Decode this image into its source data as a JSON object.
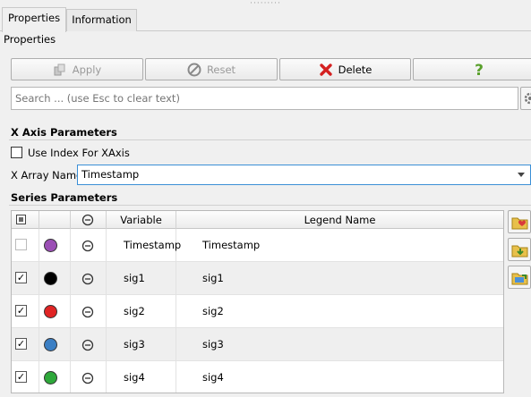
{
  "tabs": [
    {
      "label": "Properties",
      "active": true
    },
    {
      "label": "Information",
      "active": false
    }
  ],
  "panel_label": "Properties",
  "buttons": {
    "apply": "Apply",
    "reset": "Reset",
    "delete": "Delete",
    "help_icon": "question-mark-icon"
  },
  "search": {
    "placeholder": "Search ... (use Esc to clear text)",
    "value": ""
  },
  "x_axis": {
    "header": "X Axis Parameters",
    "use_index_label": "Use Index For XAxis",
    "use_index_checked": false,
    "x_array_label": "X Array Name",
    "x_array_value": "Timestamp"
  },
  "series": {
    "header": "Series Parameters",
    "columns": [
      "",
      "",
      "",
      "Variable",
      "Legend Name"
    ],
    "rows": [
      {
        "checked": false,
        "color": "#9b4fb5",
        "variable": "Timestamp",
        "legend": "Timestamp"
      },
      {
        "checked": true,
        "color": "#000000",
        "variable": "sig1",
        "legend": "sig1"
      },
      {
        "checked": true,
        "color": "#e02424",
        "variable": "sig2",
        "legend": "sig2"
      },
      {
        "checked": true,
        "color": "#3b7fc4",
        "variable": "sig3",
        "legend": "sig3"
      },
      {
        "checked": true,
        "color": "#2ea83a",
        "variable": "sig4",
        "legend": "sig4"
      }
    ]
  },
  "colors": {
    "delete_red": "#d42020",
    "help_green": "#5aa02c",
    "focus_blue": "#3b8fd6"
  }
}
